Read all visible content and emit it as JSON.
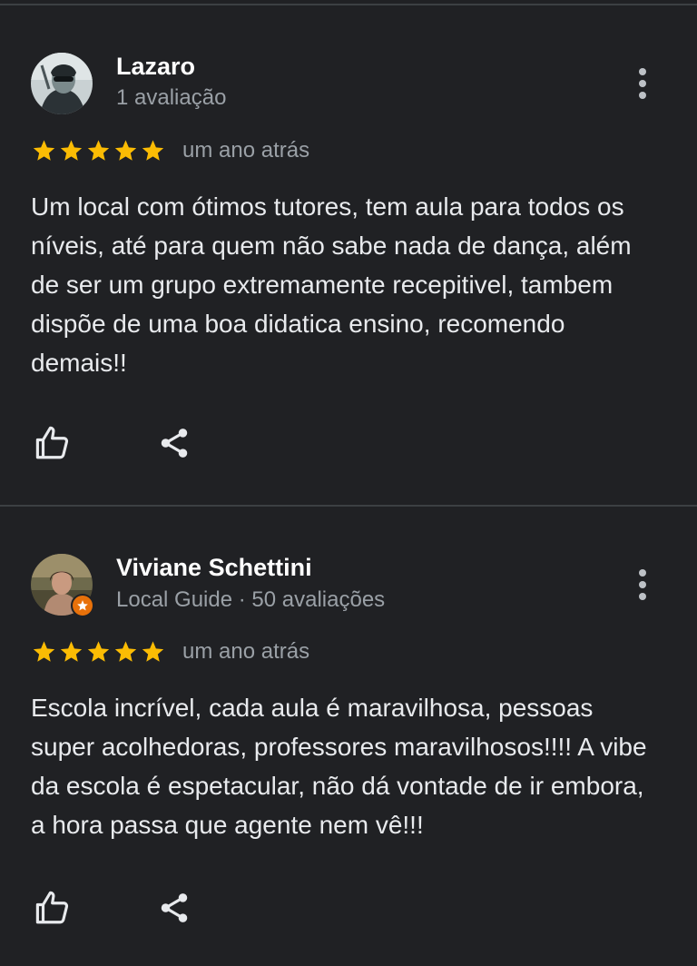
{
  "reviews": [
    {
      "name": "Lazaro",
      "meta": "1 avaliação",
      "rating": 5,
      "time": "um ano atrás",
      "text": "Um local com ótimos tutores, tem aula para todos os níveis, até para quem não sabe nada de dança, além de ser um grupo extremamente recepitivel, tambem dispõe de uma boa didatica ensino, recomendo demais!!",
      "local_guide": false,
      "icons": {
        "more": "more-vert-icon",
        "like": "thumb-up-icon",
        "share": "share-icon"
      }
    },
    {
      "name": "Viviane Schettini",
      "meta": "Local Guide · 50 avaliações",
      "rating": 5,
      "time": "um ano atrás",
      "text": "Escola incrível, cada aula é maravilhosa, pessoas super acolhedoras, professores maravilhosos!!!! A vibe da escola é espetacular, não dá vontade de ir embora, a hora passa que agente nem vê!!!",
      "local_guide": true,
      "icons": {
        "more": "more-vert-icon",
        "like": "thumb-up-icon",
        "share": "share-icon",
        "badge": "local-guide-star-icon"
      }
    }
  ],
  "colors": {
    "background": "#202124",
    "star": "#fbbc04",
    "text": "#e8eaed",
    "secondary": "#9aa0a6",
    "badge": "#e8710a",
    "divider": "#3c4043"
  }
}
